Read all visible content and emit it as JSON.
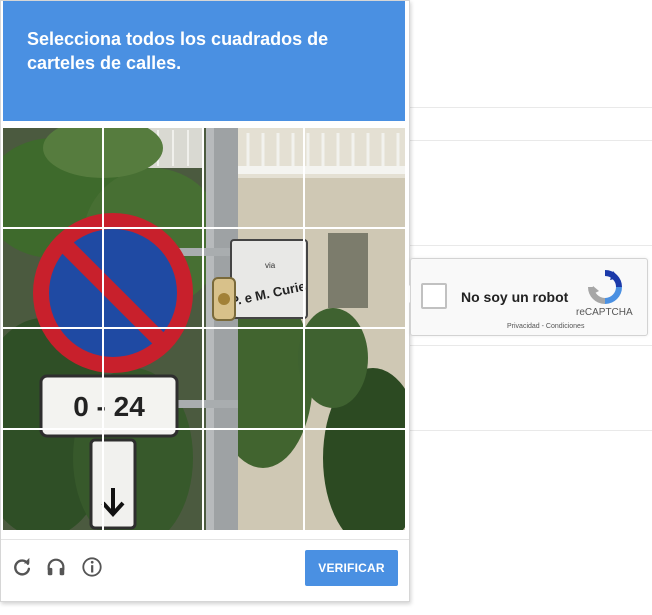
{
  "challenge": {
    "prompt": "Selecciona todos los cuadrados de carteles de calles.",
    "header_color": "#4a90e2",
    "grid": {
      "rows": 4,
      "columns": 4
    },
    "image": {
      "sign_distance_text": "0 - 24",
      "street_sign_text": "P. e M. Curie",
      "street_sign_prefix": "via"
    },
    "footer": {
      "reload_icon": "reload-icon",
      "audio_icon": "headphones-icon",
      "info_icon": "info-icon",
      "verify_label": "VERIFICAR"
    }
  },
  "anchor": {
    "checkbox_label": "No soy un robot",
    "brand": "reCAPTCHA",
    "privacy_label": "Privacidad",
    "separator": " - ",
    "terms_label": "Condiciones",
    "logo_icon": "recaptcha-logo-icon"
  }
}
